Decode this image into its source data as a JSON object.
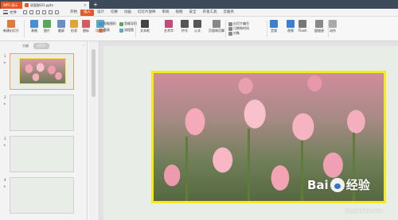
{
  "titlebar": {
    "app_label": "WPS 演示",
    "doc_label": "双面胶印1.pptx",
    "new_tab": "+"
  },
  "menubar": {
    "file_label": "文件",
    "tabs": [
      "开始",
      "插入",
      "设计",
      "切换",
      "动画",
      "幻灯片放映",
      "审阅",
      "视图",
      "安全",
      "开发工具",
      "云服务"
    ],
    "active_index": 1
  },
  "ribbon": {
    "large_items": [
      {
        "label": "新建幻灯片",
        "color": "#e07b3b"
      },
      {
        "label": "表格",
        "color": "#4a8fd6"
      },
      {
        "label": "图片",
        "color": "#58a85a"
      },
      {
        "label": "截屏",
        "color": "#6b8fc4"
      },
      {
        "label": "形状",
        "color": "#e3a33a"
      },
      {
        "label": "图标",
        "color": "#d45c5c"
      },
      {
        "label": "功能图",
        "color": "#5aa7c2"
      },
      {
        "label": "文本框",
        "color": "#444444"
      },
      {
        "label": "艺术字",
        "color": "#c24b7a"
      },
      {
        "label": "符号",
        "color": "#555555"
      },
      {
        "label": "公式",
        "color": "#555555"
      },
      {
        "label": "页眉和页脚",
        "color": "#888888"
      },
      {
        "label": "音频",
        "color": "#3b7fd0"
      },
      {
        "label": "视频",
        "color": "#3b7fd0"
      },
      {
        "label": "Flash",
        "color": "#777777"
      },
      {
        "label": "超链接",
        "color": "#888888"
      },
      {
        "label": "动作",
        "color": "#aaaaaa"
      }
    ],
    "small_items": [
      {
        "label": "智能图形",
        "color": "#4a8fd6"
      },
      {
        "label": "图表",
        "color": "#d86b3a"
      },
      {
        "label": "思维导图",
        "color": "#58a85a"
      },
      {
        "label": "流程图",
        "color": "#5aa7c2"
      },
      {
        "label": "幻灯片编号",
        "color": "#888888"
      },
      {
        "label": "日期和时间",
        "color": "#888888"
      },
      {
        "label": "对象",
        "color": "#888888"
      }
    ]
  },
  "left_panel": {
    "tabs": [
      "大纲",
      "幻灯片"
    ],
    "active_tab": 1,
    "slides": [
      "1",
      "2",
      "3",
      "4"
    ]
  },
  "watermark": {
    "brand": "Bai",
    "brand_tail": "经验",
    "sub": "jingyan.baidu.com"
  }
}
